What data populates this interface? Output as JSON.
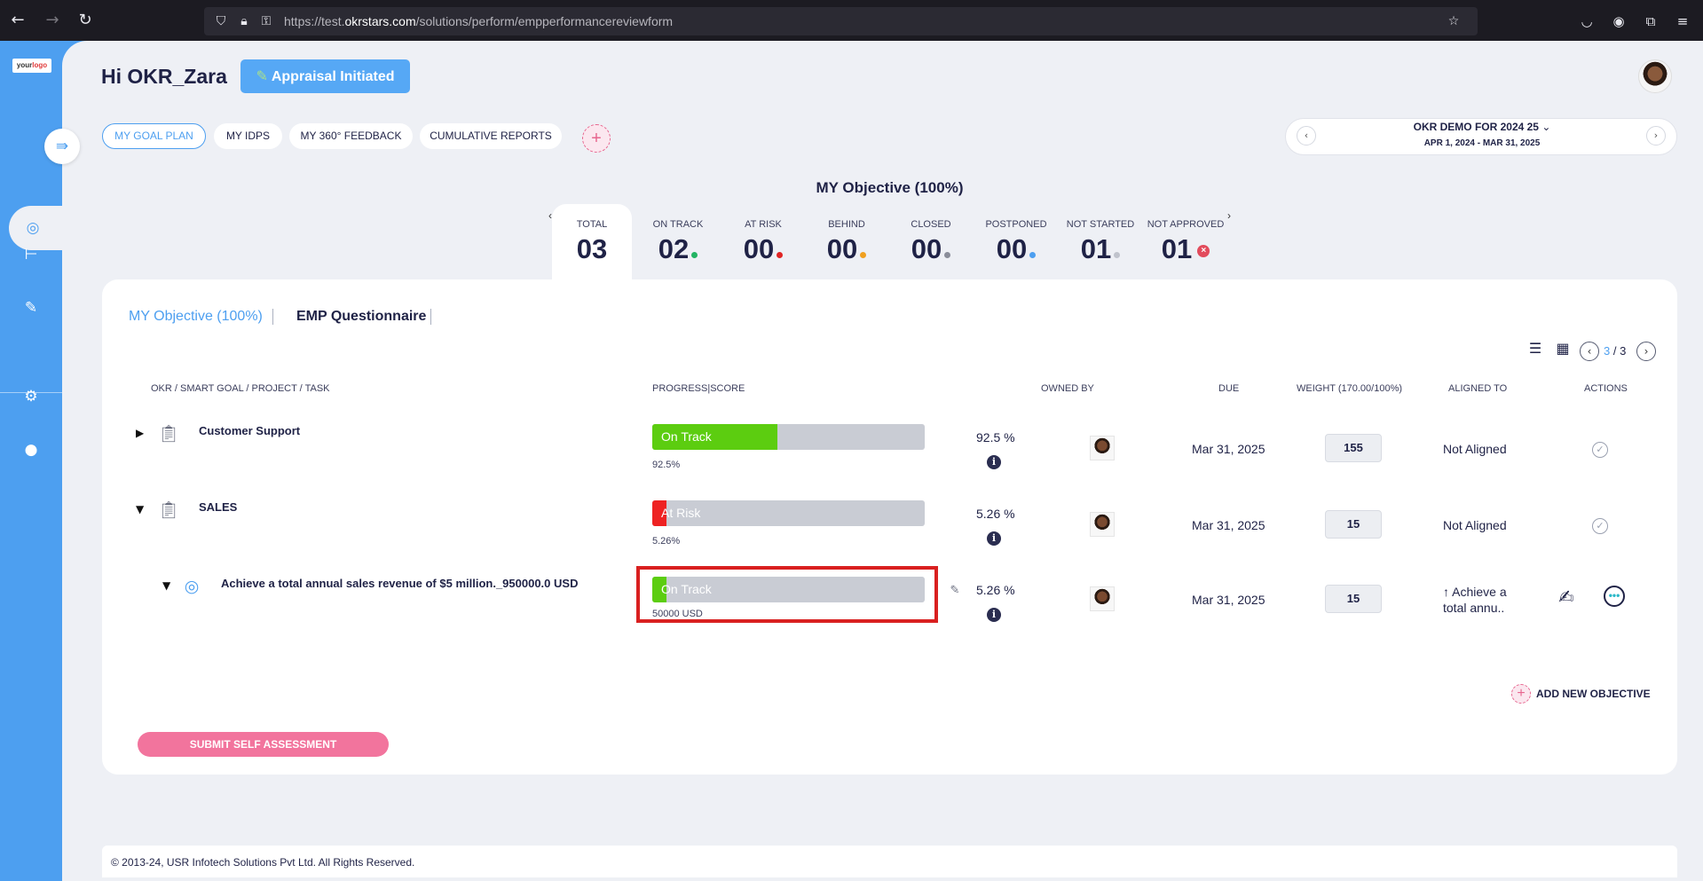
{
  "browser": {
    "url_prefix": "https://test.",
    "url_domain": "okrstars.com",
    "url_path": "/solutions/perform/empperformancereviewform"
  },
  "sidebar": {
    "logo_main": "your",
    "logo_accent": "logo"
  },
  "header": {
    "greeting": "Hi OKR_Zara",
    "appraisal_label": "Appraisal Initiated",
    "tabs": [
      {
        "label": "MY GOAL PLAN"
      },
      {
        "label": "MY IDPS"
      },
      {
        "label": "MY 360° FEEDBACK"
      },
      {
        "label": "CUMULATIVE REPORTS"
      }
    ],
    "add_tab": "+"
  },
  "period": {
    "title": "OKR DEMO FOR 2024 25",
    "range": "APR 1, 2024 - MAR 31, 2025"
  },
  "objective_title": "MY Objective (100%)",
  "stats": [
    {
      "label": "TOTAL",
      "value": "03"
    },
    {
      "label": "ON TRACK",
      "value": "02",
      "color": "#22b463"
    },
    {
      "label": "AT RISK",
      "value": "00",
      "color": "#e02424"
    },
    {
      "label": "BEHIND",
      "value": "00",
      "color": "#f0a020"
    },
    {
      "label": "CLOSED",
      "value": "00",
      "color": "#8a8d99"
    },
    {
      "label": "POSTPONED",
      "value": "00",
      "color": "#4d9ff0"
    },
    {
      "label": "NOT STARTED",
      "value": "01",
      "color": "#c0c3cc"
    },
    {
      "label": "NOT APPROVED",
      "value": "01",
      "color": "#e24b5c"
    }
  ],
  "card": {
    "tab_objective": "MY Objective (100%)",
    "tab_questionnaire": "EMP Questionnaire",
    "pager_current": "3",
    "pager_total": "/ 3",
    "columns": {
      "task": "OKR / SMART GOAL / PROJECT / TASK",
      "progress": "PROGRESS|SCORE",
      "owned": "OWNED BY",
      "due": "DUE",
      "weight": "WEIGHT (170.00/100%)",
      "aligned": "ALIGNED TO",
      "actions": "ACTIONS"
    },
    "rows": [
      {
        "title": "Customer Support",
        "status": "On Track",
        "progress": 0.46,
        "bar_color": "#5ccd10",
        "sub": "92.5%",
        "pct": "92.5  %",
        "due": "Mar 31, 2025",
        "weight": "155",
        "aligned": "Not Aligned"
      },
      {
        "title": "SALES",
        "status": "At Risk",
        "progress": 0.0526,
        "bar_color": "#ee2222",
        "sub": "5.26%",
        "pct": "5.26  %",
        "due": "Mar 31, 2025",
        "weight": "15",
        "aligned": "Not Aligned"
      },
      {
        "title": "Achieve a total annual sales revenue of $5 million._950000.0 USD",
        "status": "On Track",
        "progress": 0.0526,
        "bar_color": "#5ccd10",
        "sub": "50000 USD",
        "pct": "5.26  %",
        "due": "Mar 31, 2025",
        "weight": "15",
        "aligned_line1": "↑ Achieve a",
        "aligned_line2": "total annu.."
      }
    ],
    "add_objective": "ADD NEW OBJECTIVE",
    "submit_label": "SUBMIT SELF ASSESSMENT"
  },
  "footer": "© 2013-24, USR Infotech Solutions Pvt Ltd. All Rights Reserved."
}
